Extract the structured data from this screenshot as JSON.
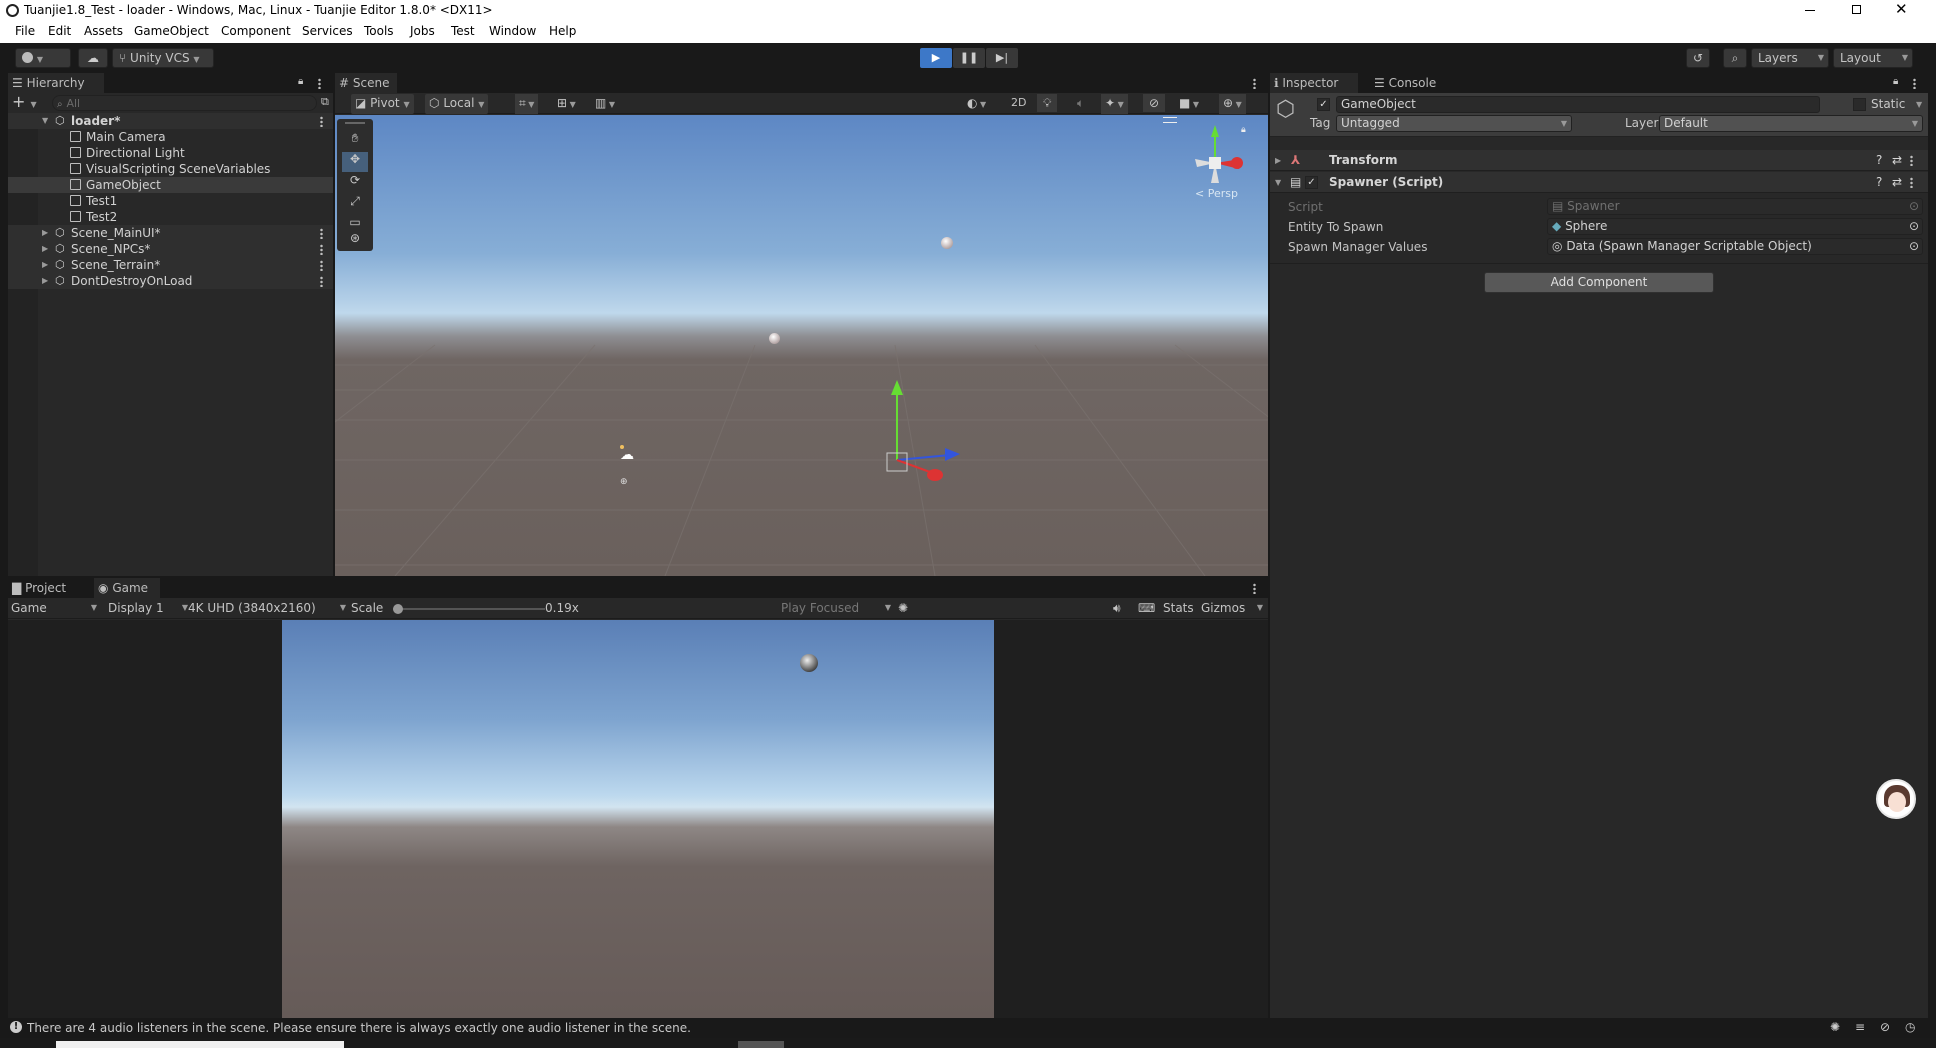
{
  "window": {
    "title": "Tuanjie1.8_Test - loader - Windows, Mac, Linux - Tuanjie Editor 1.8.0* <DX11>",
    "controls": [
      "minimize",
      "restore",
      "close"
    ]
  },
  "menu": [
    "File",
    "Edit",
    "Assets",
    "GameObject",
    "Component",
    "Services",
    "Tools",
    "Jobs",
    "Test",
    "Window",
    "Help"
  ],
  "toolbar": {
    "vcs_label": "Unity VCS",
    "layers_label": "Layers",
    "layout_label": "Layout"
  },
  "hierarchy": {
    "tab_label": "Hierarchy",
    "search_placeholder": "All",
    "items": [
      {
        "label": "loader*",
        "depth": 0,
        "kind": "scene",
        "expanded": true
      },
      {
        "label": "Main Camera",
        "depth": 1,
        "kind": "object"
      },
      {
        "label": "Directional Light",
        "depth": 1,
        "kind": "object"
      },
      {
        "label": "VisualScripting SceneVariables",
        "depth": 1,
        "kind": "object"
      },
      {
        "label": "GameObject",
        "depth": 1,
        "kind": "object",
        "selected": true
      },
      {
        "label": "Test1",
        "depth": 1,
        "kind": "object"
      },
      {
        "label": "Test2",
        "depth": 1,
        "kind": "object"
      },
      {
        "label": "Scene_MainUI*",
        "depth": 0,
        "kind": "scene",
        "expanded": false
      },
      {
        "label": "Scene_NPCs*",
        "depth": 0,
        "kind": "scene",
        "expanded": false
      },
      {
        "label": "Scene_Terrain*",
        "depth": 0,
        "kind": "scene",
        "expanded": false
      },
      {
        "label": "DontDestroyOnLoad",
        "depth": 0,
        "kind": "scene",
        "expanded": false
      }
    ]
  },
  "scene": {
    "tab_label": "Scene",
    "pivot_label": "Pivot",
    "local_label": "Local",
    "mode_2d_label": "2D",
    "persp_label": "< Persp"
  },
  "bottom": {
    "tabs": [
      "Project",
      "Game"
    ],
    "active_tab": "Game",
    "game_dropdown": "Game",
    "display_dropdown": "Display 1",
    "resolution_dropdown": "4K UHD (3840x2160)",
    "scale_label": "Scale",
    "scale_value": "0.19x",
    "scale_fraction": 0.0,
    "play_focused_label": "Play Focused",
    "stats_label": "Stats",
    "gizmos_label": "Gizmos"
  },
  "inspector": {
    "tabs": [
      "Inspector",
      "Console"
    ],
    "object_name": "GameObject",
    "static_label": "Static",
    "tag_label": "Tag",
    "tag_value": "Untagged",
    "layer_label": "Layer",
    "layer_value": "Default",
    "components": [
      {
        "name": "Transform",
        "expanded": false
      },
      {
        "name": "Spawner (Script)",
        "expanded": true,
        "enabled": true
      }
    ],
    "properties": [
      {
        "label": "Script",
        "value": "Spawner",
        "disabled": true
      },
      {
        "label": "Entity To Spawn",
        "value": "Sphere"
      },
      {
        "label": "Spawn Manager Values",
        "value": "Data (Spawn Manager Scriptable Object)"
      }
    ],
    "add_component_label": "Add Component"
  },
  "status_bar": {
    "message": "There are 4 audio listeners in the scene. Please ensure there is always exactly one audio listener in the scene."
  },
  "colors": {
    "accent_play": "#3d78c8",
    "selection": "#2c5d87",
    "axis_x": "#d33",
    "axis_y": "#6d3",
    "axis_z": "#35d"
  }
}
